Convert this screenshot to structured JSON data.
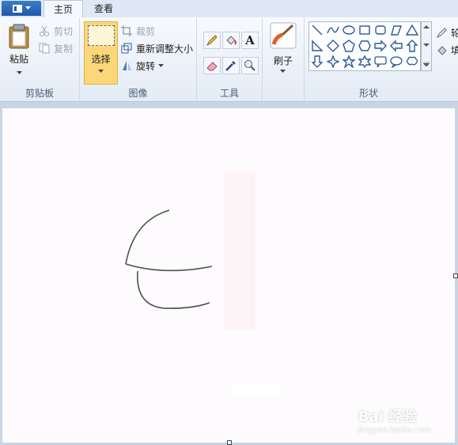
{
  "tabs": [
    {
      "label": "主页",
      "active": true
    },
    {
      "label": "查看",
      "active": false
    }
  ],
  "clipboard": {
    "paste": "粘贴",
    "cut": "剪切",
    "copy": "复制",
    "group": "剪贴板"
  },
  "image": {
    "select": "选择",
    "crop": "裁剪",
    "resize": "重新调整大小",
    "rotate": "旋转",
    "group": "图像"
  },
  "tools": {
    "group": "工具",
    "icons": [
      "pencil-icon",
      "fill-bucket-icon",
      "text-icon",
      "eraser-icon",
      "color-picker-icon",
      "magnifier-icon"
    ]
  },
  "brushes": {
    "label": "刷子"
  },
  "shapes": {
    "group": "形状",
    "icons": [
      "line",
      "curve",
      "oval",
      "rectangle",
      "rounded-rectangle",
      "polygon",
      "triangle",
      "right-triangle",
      "diamond",
      "pentagon",
      "hexagon",
      "right-arrow",
      "left-arrow",
      "up-arrow",
      "down-arrow",
      "four-point-star",
      "five-point-star",
      "six-point-star",
      "rounded-callout",
      "oval-callout",
      "cloud-callout"
    ]
  },
  "outline": {
    "label": "轮"
  },
  "fill": {
    "label": "填"
  },
  "watermark": {
    "brand": "Bai 经验",
    "url": "jingyan.baidu.com"
  },
  "colors": {
    "accent": "#1e5aa8",
    "selected": "#fbd779"
  }
}
